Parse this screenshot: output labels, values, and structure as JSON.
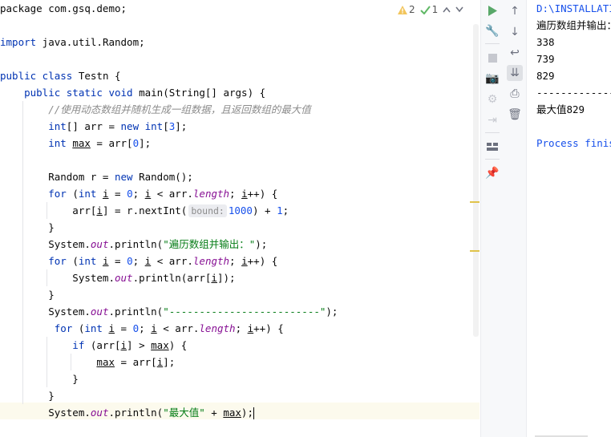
{
  "inspections": {
    "warnings": "2",
    "weak_warnings": "1"
  },
  "code": [
    [
      {
        "t": "package com.gsq.demo;",
        "c": ""
      }
    ],
    [],
    [
      {
        "t": "import",
        "c": "kw"
      },
      {
        "t": " java.util.Random;",
        "c": ""
      }
    ],
    [],
    [
      {
        "t": "public class",
        "c": "kw"
      },
      {
        "t": " Testn {",
        "c": ""
      }
    ],
    [
      {
        "t": "    public static void",
        "c": "kw"
      },
      {
        "t": " main(String[] args) {",
        "c": ""
      }
    ],
    [
      {
        "t": "        //使用动态数组并随机生成一组数据，且返回数组的最大值",
        "c": "cmt"
      }
    ],
    [
      {
        "t": "        int",
        "c": "kw"
      },
      {
        "t": "[] arr = ",
        "c": ""
      },
      {
        "t": "new int",
        "c": "kw"
      },
      {
        "t": "[",
        "c": ""
      },
      {
        "t": "3",
        "c": "num"
      },
      {
        "t": "];",
        "c": ""
      }
    ],
    [
      {
        "t": "        int ",
        "c": "kw"
      },
      {
        "t": "max",
        "c": "ul"
      },
      {
        "t": " = arr[",
        "c": ""
      },
      {
        "t": "0",
        "c": "num"
      },
      {
        "t": "];",
        "c": ""
      }
    ],
    [],
    [
      {
        "t": "        Random r = ",
        "c": ""
      },
      {
        "t": "new",
        "c": "kw"
      },
      {
        "t": " Random();",
        "c": ""
      }
    ],
    [
      {
        "t": "        for",
        "c": "kw"
      },
      {
        "t": " (",
        "c": ""
      },
      {
        "t": "int ",
        "c": "kw"
      },
      {
        "t": "i",
        "c": "ul"
      },
      {
        "t": " = ",
        "c": ""
      },
      {
        "t": "0",
        "c": "num"
      },
      {
        "t": "; ",
        "c": ""
      },
      {
        "t": "i",
        "c": "ul"
      },
      {
        "t": " < arr.",
        "c": ""
      },
      {
        "t": "length",
        "c": "fld"
      },
      {
        "t": "; ",
        "c": ""
      },
      {
        "t": "i",
        "c": "ul"
      },
      {
        "t": "++) {",
        "c": ""
      }
    ],
    [
      {
        "t": "            arr[",
        "c": ""
      },
      {
        "t": "i",
        "c": "ul"
      },
      {
        "t": "] = r.nextInt(",
        "c": ""
      },
      {
        "t": "bound:",
        "c": "hint"
      },
      {
        "t": "1000",
        "c": "num"
      },
      {
        "t": ") + ",
        "c": ""
      },
      {
        "t": "1",
        "c": "num"
      },
      {
        "t": ";",
        "c": ""
      }
    ],
    [
      {
        "t": "        }",
        "c": ""
      }
    ],
    [
      {
        "t": "        System.",
        "c": ""
      },
      {
        "t": "out",
        "c": "fld"
      },
      {
        "t": ".println(",
        "c": ""
      },
      {
        "t": "\"遍历数组并输出：\"",
        "c": "str"
      },
      {
        "t": ");",
        "c": ""
      }
    ],
    [
      {
        "t": "        for",
        "c": "kw"
      },
      {
        "t": " (",
        "c": ""
      },
      {
        "t": "int ",
        "c": "kw"
      },
      {
        "t": "i",
        "c": "ul"
      },
      {
        "t": " = ",
        "c": ""
      },
      {
        "t": "0",
        "c": "num"
      },
      {
        "t": "; ",
        "c": ""
      },
      {
        "t": "i",
        "c": "ul"
      },
      {
        "t": " < arr.",
        "c": ""
      },
      {
        "t": "length",
        "c": "fld"
      },
      {
        "t": "; ",
        "c": ""
      },
      {
        "t": "i",
        "c": "ul"
      },
      {
        "t": "++) {",
        "c": ""
      }
    ],
    [
      {
        "t": "            System.",
        "c": ""
      },
      {
        "t": "out",
        "c": "fld"
      },
      {
        "t": ".println(arr[",
        "c": ""
      },
      {
        "t": "i",
        "c": "ul"
      },
      {
        "t": "]);",
        "c": ""
      }
    ],
    [
      {
        "t": "        }",
        "c": ""
      }
    ],
    [
      {
        "t": "        System.",
        "c": ""
      },
      {
        "t": "out",
        "c": "fld"
      },
      {
        "t": ".println(",
        "c": ""
      },
      {
        "t": "\"-------------------------\"",
        "c": "str"
      },
      {
        "t": ");",
        "c": ""
      }
    ],
    [
      {
        "t": "         for",
        "c": "kw"
      },
      {
        "t": " (",
        "c": ""
      },
      {
        "t": "int ",
        "c": "kw"
      },
      {
        "t": "i",
        "c": "ul"
      },
      {
        "t": " = ",
        "c": ""
      },
      {
        "t": "0",
        "c": "num"
      },
      {
        "t": "; ",
        "c": ""
      },
      {
        "t": "i",
        "c": "ul"
      },
      {
        "t": " < arr.",
        "c": ""
      },
      {
        "t": "length",
        "c": "fld"
      },
      {
        "t": "; ",
        "c": ""
      },
      {
        "t": "i",
        "c": "ul"
      },
      {
        "t": "++) {",
        "c": ""
      }
    ],
    [
      {
        "t": "            if",
        "c": "kw"
      },
      {
        "t": " (arr[",
        "c": ""
      },
      {
        "t": "i",
        "c": "ul"
      },
      {
        "t": "] > ",
        "c": ""
      },
      {
        "t": "max",
        "c": "ul"
      },
      {
        "t": ") {",
        "c": ""
      }
    ],
    [
      {
        "t": "                ",
        "c": ""
      },
      {
        "t": "max",
        "c": "ul"
      },
      {
        "t": " = arr[",
        "c": ""
      },
      {
        "t": "i",
        "c": "ul"
      },
      {
        "t": "];",
        "c": ""
      }
    ],
    [
      {
        "t": "            }",
        "c": ""
      }
    ],
    [
      {
        "t": "        }",
        "c": ""
      }
    ],
    [
      {
        "t": "        System.",
        "c": ""
      },
      {
        "t": "out",
        "c": "fld"
      },
      {
        "t": ".println(",
        "c": ""
      },
      {
        "t": "\"最大值\"",
        "c": "str"
      },
      {
        "t": " + ",
        "c": ""
      },
      {
        "t": "max",
        "c": "ul"
      },
      {
        "t": ");",
        "c": ""
      }
    ]
  ],
  "console_lines": [
    {
      "text": "D:\\INSTALLATIO",
      "c": "cblue"
    },
    {
      "text": "遍历数组并输出：",
      "c": ""
    },
    {
      "text": "338",
      "c": ""
    },
    {
      "text": "739",
      "c": ""
    },
    {
      "text": "829",
      "c": ""
    },
    {
      "text": "-------------",
      "c": ""
    },
    {
      "text": "最大值829",
      "c": ""
    },
    {
      "text": "",
      "c": ""
    },
    {
      "text": "Process finish",
      "c": "cblue"
    }
  ]
}
